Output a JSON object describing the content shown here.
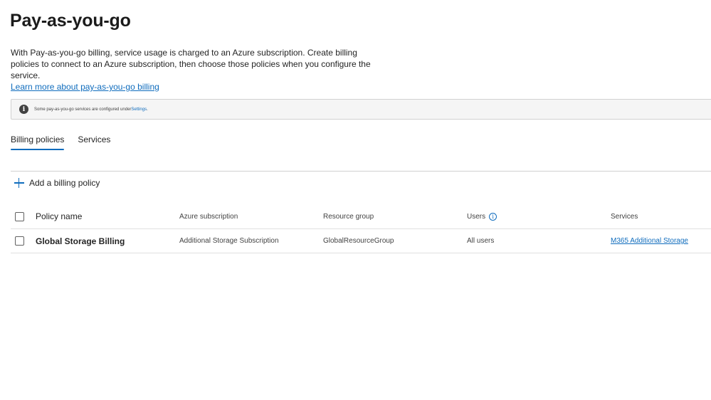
{
  "page": {
    "title": "Pay-as-you-go",
    "description": "With Pay-as-you-go billing, service usage is charged to an Azure subscription. Create billing policies to connect to an Azure subscription, then choose those policies when you configure the service.",
    "learn_more_link": "Learn more about pay-as-you-go billing"
  },
  "notice": {
    "icon": "info-icon",
    "text": "Some pay-as-you-go services are configured under ",
    "link": "Settings",
    "suffix": "."
  },
  "tabs": [
    {
      "label": "Billing policies",
      "active": true
    },
    {
      "label": "Services",
      "active": false
    }
  ],
  "toolbar": {
    "add_label": "Add a billing policy",
    "add_icon": "plus-icon"
  },
  "table": {
    "columns": {
      "name": "Policy name",
      "subscription": "Azure subscription",
      "resource_group": "Resource group",
      "users": "Users",
      "services": "Services"
    },
    "rows": [
      {
        "name": "Global Storage Billing",
        "subscription": "Additional Storage Subscription",
        "resource_group": "GlobalResourceGroup",
        "users": "All users",
        "services": "M365 Additional Storage"
      }
    ]
  },
  "colors": {
    "accent": "#0f6cbd",
    "text": "#242424",
    "notice_bg": "#f5f5f5"
  }
}
